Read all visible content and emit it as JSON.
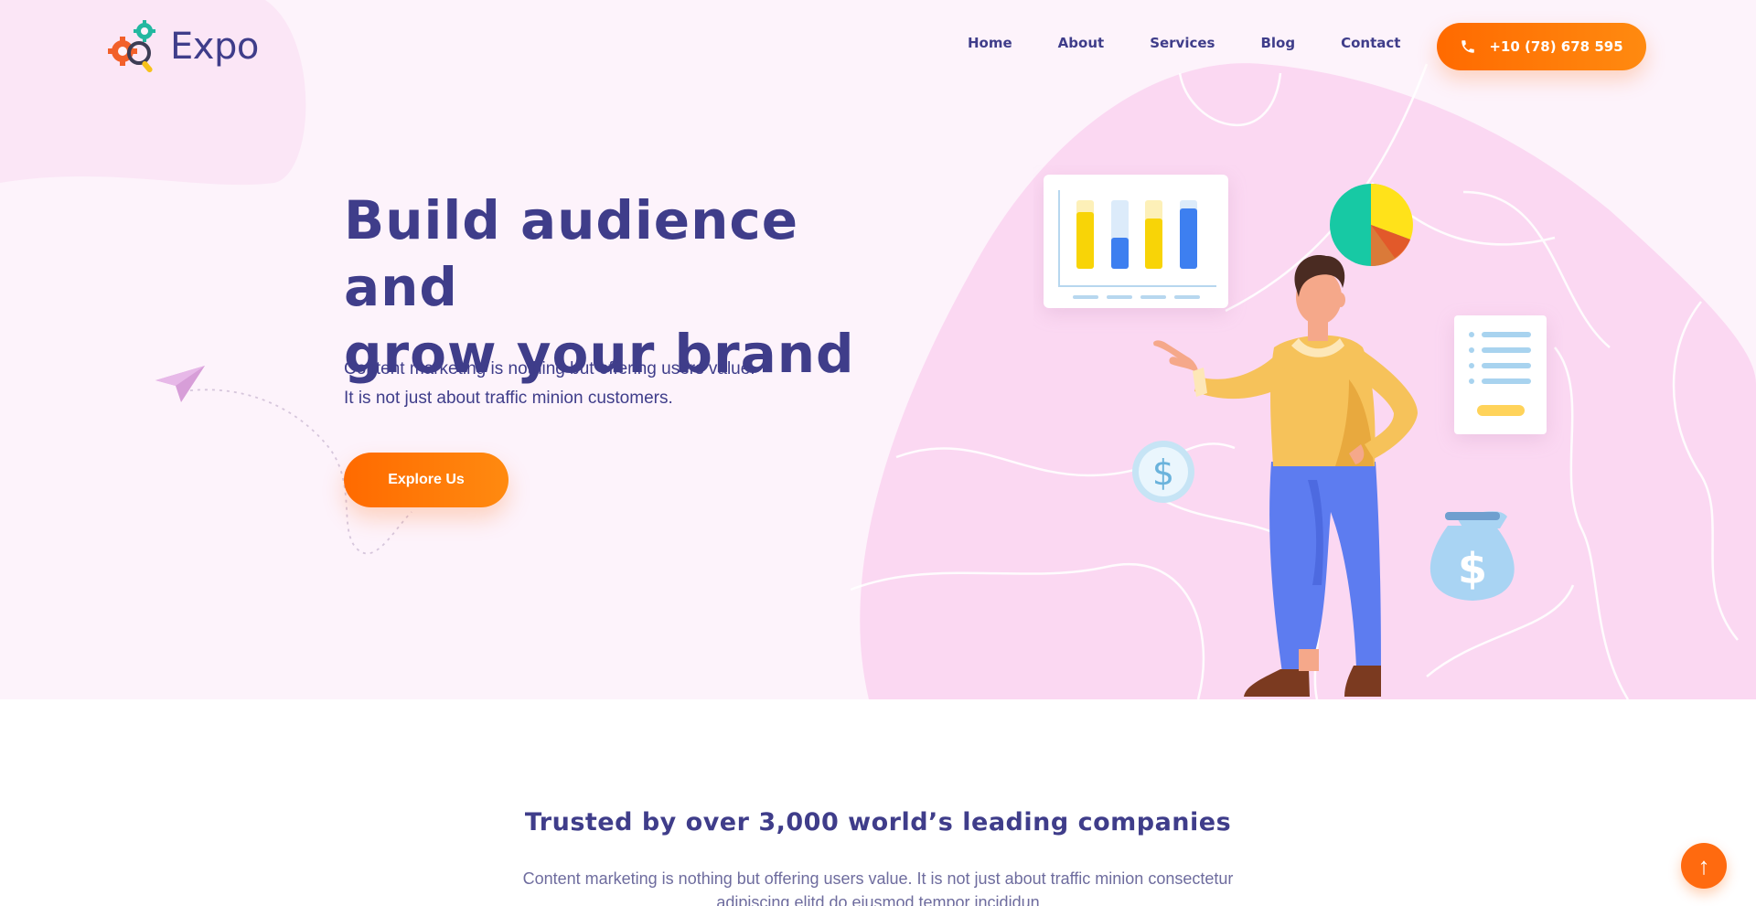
{
  "brand": {
    "name": "Expo"
  },
  "nav": {
    "items": [
      {
        "label": "Home"
      },
      {
        "label": "About"
      },
      {
        "label": "Services"
      },
      {
        "label": "Blog"
      },
      {
        "label": "Contact"
      }
    ],
    "phone": "+10 (78) 678 595"
  },
  "hero": {
    "title_line1": "Build audience and",
    "title_line2": "grow your brand",
    "desc_line1": "Content marketing is nothing but offering users value.",
    "desc_line2": "It is not just about traffic minion customers.",
    "cta": "Explore Us"
  },
  "trusted": {
    "title": "Trusted by over 3,000 world’s leading companies",
    "desc": "Content marketing is nothing but offering users value. It is not just about traffic minion consectetur adipiscing elitd do eiusmod tempor incididun"
  },
  "icons": {
    "phone": "phone-icon",
    "scroll_top": "arrow-up-icon",
    "plane": "paper-plane-icon"
  },
  "colors": {
    "primary": "#3f3d8a",
    "accent": "#ff6a00",
    "hero_bg": "#fdf3fb",
    "blob": "#fbd8f2"
  }
}
